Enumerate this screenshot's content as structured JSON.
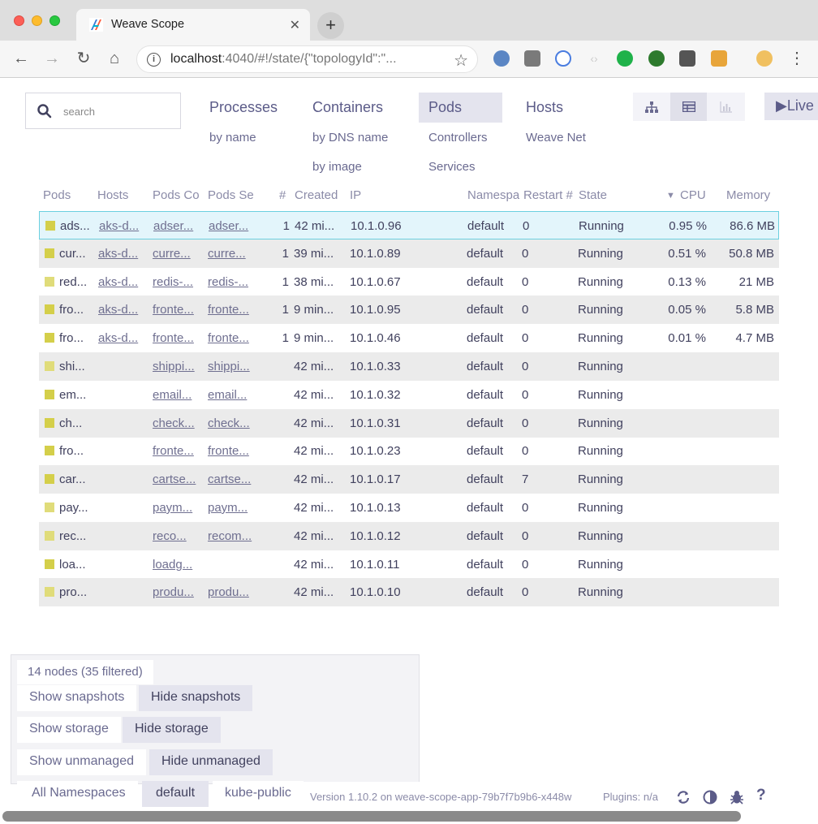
{
  "browser": {
    "tab_title": "Weave Scope",
    "tab_close": "✕",
    "new_tab": "+",
    "url_host": "localhost",
    "url_rest": ":4040/#!/state/{\"topologyId\":\"...",
    "back": "←",
    "forward": "→",
    "reload": "↻",
    "home": "⌂",
    "star": "☆",
    "menu": "⋮"
  },
  "search": {
    "placeholder": "search"
  },
  "topologies": [
    {
      "label": "Processes",
      "subs": [
        "by name"
      ]
    },
    {
      "label": "Containers",
      "subs": [
        "by DNS name",
        "by image"
      ]
    },
    {
      "label": "Pods",
      "subs": [
        "Controllers",
        "Services"
      ]
    },
    {
      "label": "Hosts",
      "subs": [
        "Weave Net"
      ]
    }
  ],
  "live_label": "Live",
  "table": {
    "headers": [
      "Pods",
      "Hosts",
      "Pods Co",
      "Pods Se",
      "#",
      "Created",
      "IP",
      "Namespa",
      "Restart #",
      "State",
      "CPU",
      "Memory"
    ],
    "sort_indicator": "▼",
    "rows": [
      {
        "pod": "ads...",
        "host": "aks-d...",
        "controller": "adser...",
        "service": "adser...",
        "count": "1",
        "created": "42 mi...",
        "ip": "10.1.0.96",
        "ns": "default",
        "restarts": "0",
        "state": "Running",
        "cpu": "0.95 %",
        "mem": "86.6 MB",
        "color": "#d4cf4a"
      },
      {
        "pod": "cur...",
        "host": "aks-d...",
        "controller": "curre...",
        "service": "curre...",
        "count": "1",
        "created": "39 mi...",
        "ip": "10.1.0.89",
        "ns": "default",
        "restarts": "0",
        "state": "Running",
        "cpu": "0.51 %",
        "mem": "50.8 MB",
        "color": "#d4cf4a"
      },
      {
        "pod": "red...",
        "host": "aks-d...",
        "controller": "redis-...",
        "service": "redis-...",
        "count": "1",
        "created": "38 mi...",
        "ip": "10.1.0.67",
        "ns": "default",
        "restarts": "0",
        "state": "Running",
        "cpu": "0.13 %",
        "mem": "21 MB",
        "color": "#e0dc7a"
      },
      {
        "pod": "fro...",
        "host": "aks-d...",
        "controller": "fronte...",
        "service": "fronte...",
        "count": "1",
        "created": "9 min...",
        "ip": "10.1.0.95",
        "ns": "default",
        "restarts": "0",
        "state": "Running",
        "cpu": "0.05 %",
        "mem": "5.8 MB",
        "color": "#d4cf4a"
      },
      {
        "pod": "fro...",
        "host": "aks-d...",
        "controller": "fronte...",
        "service": "fronte...",
        "count": "1",
        "created": "9 min...",
        "ip": "10.1.0.46",
        "ns": "default",
        "restarts": "0",
        "state": "Running",
        "cpu": "0.01 %",
        "mem": "4.7 MB",
        "color": "#d4cf4a"
      },
      {
        "pod": "shi...",
        "host": "",
        "controller": "shippi...",
        "service": "shippi...",
        "count": "",
        "created": "42 mi...",
        "ip": "10.1.0.33",
        "ns": "default",
        "restarts": "0",
        "state": "Running",
        "cpu": "",
        "mem": "",
        "color": "#e0dc7a"
      },
      {
        "pod": "em...",
        "host": "",
        "controller": "email...",
        "service": "email...",
        "count": "",
        "created": "42 mi...",
        "ip": "10.1.0.32",
        "ns": "default",
        "restarts": "0",
        "state": "Running",
        "cpu": "",
        "mem": "",
        "color": "#d4cf4a"
      },
      {
        "pod": "ch...",
        "host": "",
        "controller": "check...",
        "service": "check...",
        "count": "",
        "created": "42 mi...",
        "ip": "10.1.0.31",
        "ns": "default",
        "restarts": "0",
        "state": "Running",
        "cpu": "",
        "mem": "",
        "color": "#d4cf4a"
      },
      {
        "pod": "fro...",
        "host": "",
        "controller": "fronte...",
        "service": "fronte...",
        "count": "",
        "created": "42 mi...",
        "ip": "10.1.0.23",
        "ns": "default",
        "restarts": "0",
        "state": "Running",
        "cpu": "",
        "mem": "",
        "color": "#d4cf4a"
      },
      {
        "pod": "car...",
        "host": "",
        "controller": "cartse...",
        "service": "cartse...",
        "count": "",
        "created": "42 mi...",
        "ip": "10.1.0.17",
        "ns": "default",
        "restarts": "7",
        "state": "Running",
        "cpu": "",
        "mem": "",
        "color": "#d4cf4a"
      },
      {
        "pod": "pay...",
        "host": "",
        "controller": "paym...",
        "service": "paym...",
        "count": "",
        "created": "42 mi...",
        "ip": "10.1.0.13",
        "ns": "default",
        "restarts": "0",
        "state": "Running",
        "cpu": "",
        "mem": "",
        "color": "#e0dc7a"
      },
      {
        "pod": "rec...",
        "host": "",
        "controller": "reco...",
        "service": "recom...",
        "count": "",
        "created": "42 mi...",
        "ip": "10.1.0.12",
        "ns": "default",
        "restarts": "0",
        "state": "Running",
        "cpu": "",
        "mem": "",
        "color": "#e0dc7a"
      },
      {
        "pod": "loa...",
        "host": "",
        "controller": "loadg...",
        "service": "",
        "count": "",
        "created": "42 mi...",
        "ip": "10.1.0.11",
        "ns": "default",
        "restarts": "0",
        "state": "Running",
        "cpu": "",
        "mem": "",
        "color": "#d4cf4a"
      },
      {
        "pod": "pro...",
        "host": "",
        "controller": "produ...",
        "service": "produ...",
        "count": "",
        "created": "42 mi...",
        "ip": "10.1.0.10",
        "ns": "default",
        "restarts": "0",
        "state": "Running",
        "cpu": "",
        "mem": "",
        "color": "#e0dc7a"
      }
    ]
  },
  "status": {
    "nodes": "14 nodes (35 filtered)",
    "show_snapshots": "Show snapshots",
    "hide_snapshots": "Hide snapshots",
    "show_storage": "Show storage",
    "hide_storage": "Hide storage",
    "show_unmanaged": "Show unmanaged",
    "hide_unmanaged": "Hide unmanaged",
    "namespaces": [
      "All Namespaces",
      "default",
      "kube-public"
    ]
  },
  "footer": {
    "version": "Version 1.10.2 on weave-scope-app-79b7f7b9b6-x448w",
    "plugins": "Plugins: n/a"
  },
  "colors": {
    "accent": "#5b5b88",
    "selected_row": "#e3f5fb",
    "selected_border": "#6bd0e0"
  }
}
